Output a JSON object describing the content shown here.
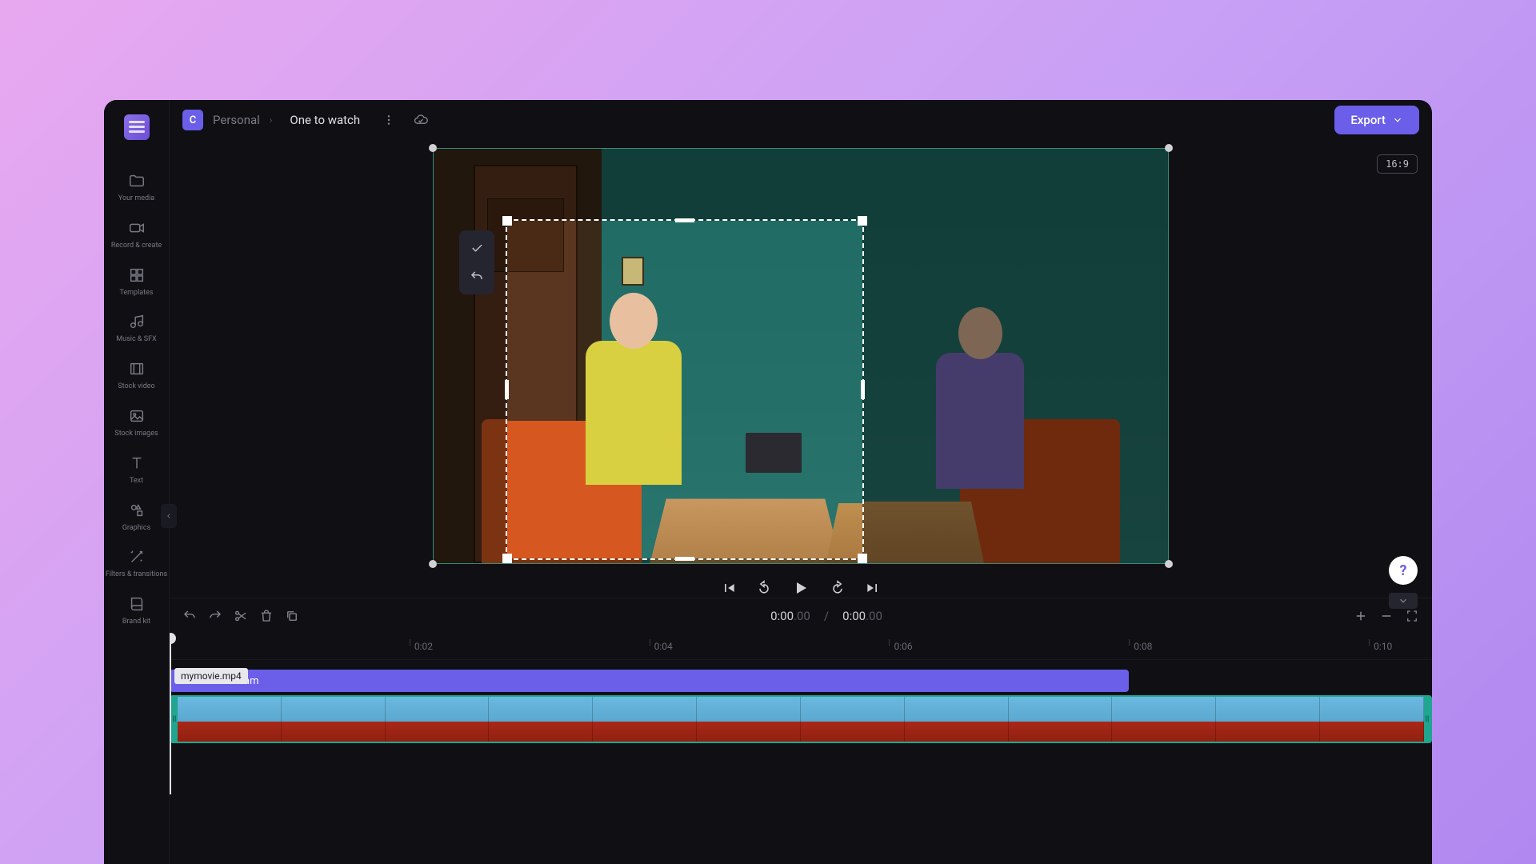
{
  "workspace": {
    "badge": "C",
    "name": "Personal"
  },
  "project": {
    "name": "One to watch"
  },
  "export_label": "Export",
  "aspect_ratio": "16:9",
  "sidebar": {
    "items": [
      {
        "label": "Your media"
      },
      {
        "label": "Record & create"
      },
      {
        "label": "Templates"
      },
      {
        "label": "Music & SFX"
      },
      {
        "label": "Stock video"
      },
      {
        "label": "Stock images"
      },
      {
        "label": "Text"
      },
      {
        "label": "Graphics"
      },
      {
        "label": "Filters & transitions"
      },
      {
        "label": "Brand kit"
      }
    ]
  },
  "timecode": {
    "current": "0:00",
    "current_ms": ".00",
    "total": "0:00",
    "total_ms": ".00"
  },
  "ruler": {
    "ticks": [
      {
        "label": "0:02",
        "pos_pct": 19
      },
      {
        "label": "0:04",
        "pos_pct": 38
      },
      {
        "label": "0:06",
        "pos_pct": 57
      },
      {
        "label": "0:08",
        "pos_pct": 76
      },
      {
        "label": "0:10",
        "pos_pct": 95
      }
    ]
  },
  "tracks": {
    "text_clip": {
      "label": "Dare to dream",
      "tooltip": "mymovie.mp4",
      "width_pct": 76
    },
    "video_clip": {
      "thumbs": 12
    }
  }
}
